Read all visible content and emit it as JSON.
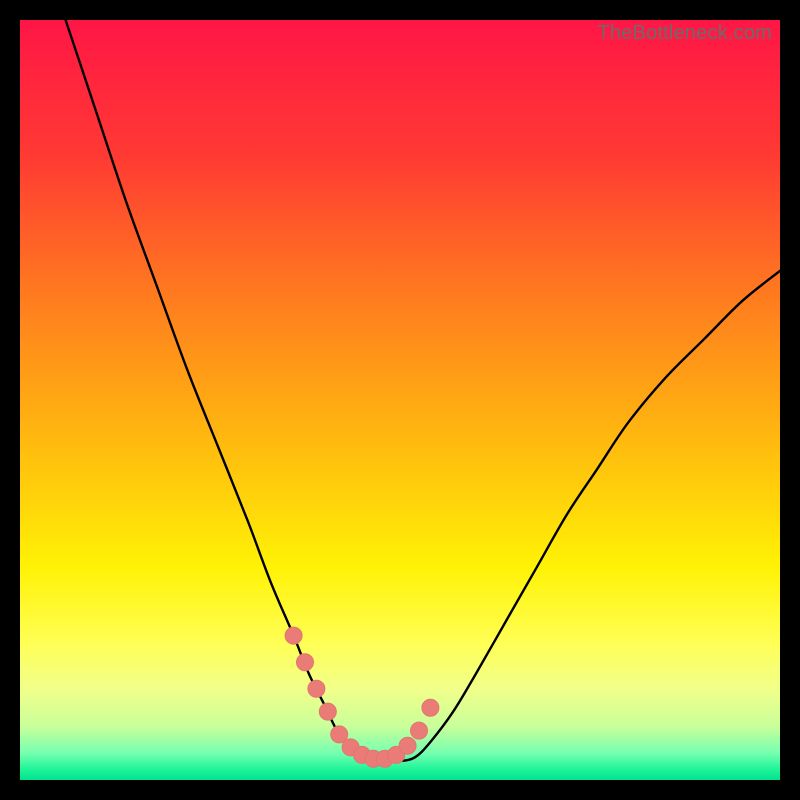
{
  "watermark": {
    "text": "TheBottleneck.com"
  },
  "colors": {
    "frame": "#000000",
    "gradient_stops": [
      {
        "offset": 0.0,
        "color": "#ff1646"
      },
      {
        "offset": 0.18,
        "color": "#ff3a33"
      },
      {
        "offset": 0.36,
        "color": "#ff7a1f"
      },
      {
        "offset": 0.55,
        "color": "#ffb80f"
      },
      {
        "offset": 0.72,
        "color": "#fff205"
      },
      {
        "offset": 0.82,
        "color": "#ffff55"
      },
      {
        "offset": 0.88,
        "color": "#f1ff8a"
      },
      {
        "offset": 0.93,
        "color": "#c8ff9a"
      },
      {
        "offset": 0.965,
        "color": "#74ffb0"
      },
      {
        "offset": 0.985,
        "color": "#23f59a"
      },
      {
        "offset": 1.0,
        "color": "#00e38f"
      }
    ],
    "curve": "#000000",
    "marker": "#e4746f",
    "marker_fill": "#e97c77"
  },
  "chart_data": {
    "type": "line",
    "title": "",
    "xlabel": "",
    "ylabel": "",
    "xlim": [
      0,
      100
    ],
    "ylim": [
      0,
      100
    ],
    "grid": false,
    "legend": false,
    "series": [
      {
        "name": "bottleneck-curve",
        "x": [
          6,
          10,
          14,
          18,
          22,
          26,
          30,
          33,
          36,
          38,
          40,
          42,
          44,
          46,
          48,
          50,
          52,
          54,
          57,
          60,
          64,
          68,
          72,
          76,
          80,
          85,
          90,
          95,
          100
        ],
        "y": [
          100,
          88,
          76,
          65,
          54,
          44,
          34,
          26,
          19,
          14,
          10,
          6,
          4,
          3,
          2.5,
          2.5,
          3,
          5,
          9,
          14,
          21,
          28,
          35,
          41,
          47,
          53,
          58,
          63,
          67
        ]
      }
    ],
    "markers": {
      "name": "highlight-band",
      "x": [
        36,
        37.5,
        39,
        40.5,
        42,
        43.5,
        45,
        46.5,
        48,
        49.5,
        51,
        52.5,
        54
      ],
      "y": [
        19,
        15.5,
        12,
        9,
        6,
        4.3,
        3.3,
        2.8,
        2.8,
        3.3,
        4.5,
        6.5,
        9.5
      ]
    }
  }
}
